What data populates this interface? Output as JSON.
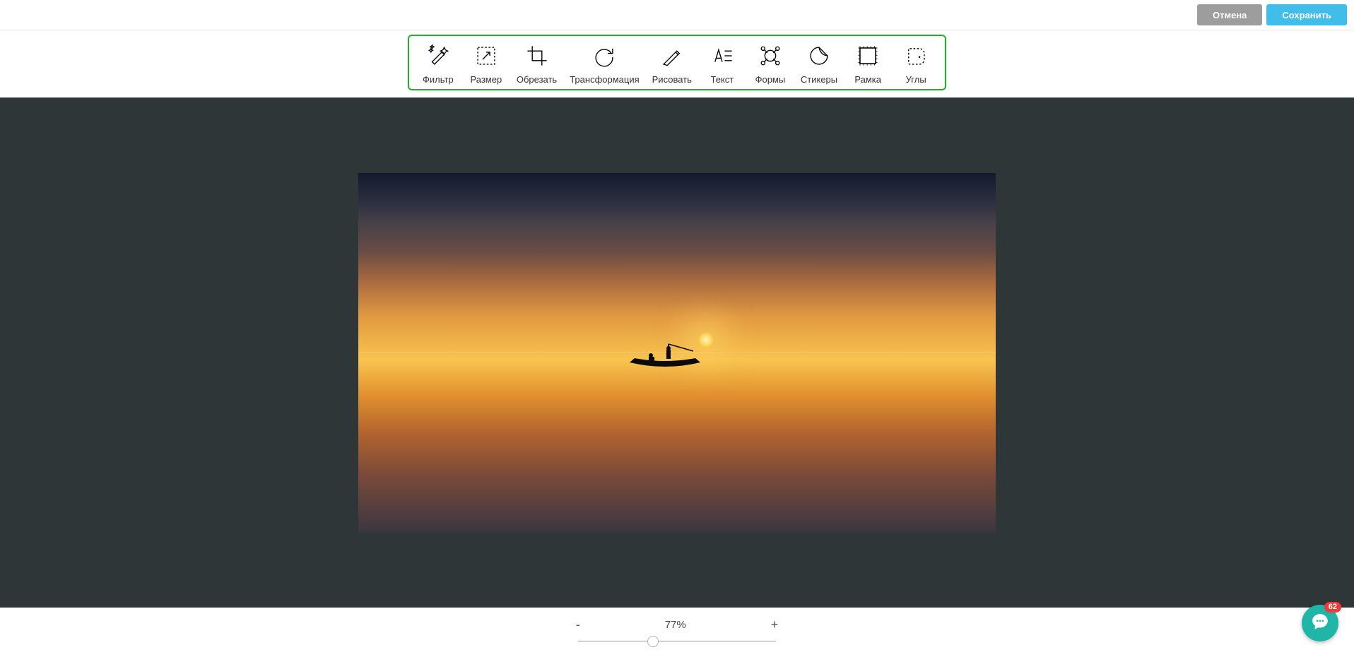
{
  "header": {
    "cancel_label": "Отмена",
    "save_label": "Сохранить"
  },
  "toolbar": {
    "items": [
      {
        "name": "filter",
        "label": "Фильтр"
      },
      {
        "name": "resize",
        "label": "Размер"
      },
      {
        "name": "crop",
        "label": "Обрезать"
      },
      {
        "name": "transform",
        "label": "Трансформация"
      },
      {
        "name": "draw",
        "label": "Рисовать"
      },
      {
        "name": "text",
        "label": "Текст"
      },
      {
        "name": "shapes",
        "label": "Формы"
      },
      {
        "name": "stickers",
        "label": "Стикеры"
      },
      {
        "name": "frame",
        "label": "Рамка"
      },
      {
        "name": "corners",
        "label": "Углы"
      }
    ]
  },
  "zoom": {
    "minus": "-",
    "plus": "+",
    "value": "77%",
    "slider_percent": 38
  },
  "chat": {
    "badge": "62"
  }
}
